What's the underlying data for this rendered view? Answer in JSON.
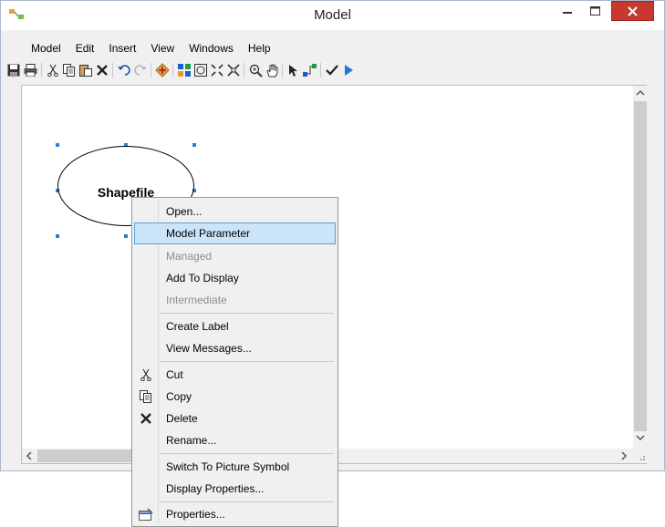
{
  "window": {
    "title": "Model"
  },
  "menu": [
    "Model",
    "Edit",
    "Insert",
    "View",
    "Windows",
    "Help"
  ],
  "toolbar_icons": [
    "save-icon",
    "print-icon",
    "cut-icon",
    "copy-icon",
    "paste-icon",
    "delete-icon",
    "undo-icon",
    "redo-icon",
    "add-data-icon",
    "auto-layout-icon",
    "full-extent-icon",
    "zoom-in-fixed-icon",
    "zoom-out-fixed-icon",
    "zoom-icon",
    "pan-icon",
    "select-icon",
    "connect-icon",
    "validate-icon",
    "run-icon"
  ],
  "canvas": {
    "element_label": "Shapefile"
  },
  "context_menu": {
    "items": [
      {
        "label": "Open...",
        "state": "normal"
      },
      {
        "label": "Model Parameter",
        "state": "hover"
      },
      {
        "label": "Managed",
        "state": "disabled"
      },
      {
        "label": "Add To Display",
        "state": "normal"
      },
      {
        "label": "Intermediate",
        "state": "disabled"
      },
      {
        "label": "Create Label",
        "state": "normal"
      },
      {
        "label": "View Messages...",
        "state": "normal"
      },
      {
        "label": "Cut",
        "state": "normal",
        "icon": "cut-icon"
      },
      {
        "label": "Copy",
        "state": "normal",
        "icon": "copy-icon"
      },
      {
        "label": "Delete",
        "state": "normal",
        "icon": "delete-icon"
      },
      {
        "label": "Rename...",
        "state": "normal"
      },
      {
        "label": "Switch To Picture Symbol",
        "state": "normal"
      },
      {
        "label": "Display Properties...",
        "state": "normal"
      },
      {
        "label": "Properties...",
        "state": "normal",
        "icon": "properties-icon"
      }
    ]
  },
  "colors": {
    "close_button": "#c7392e",
    "selection_handle": "#2a7fd4",
    "menu_hover": "#cce4f7"
  }
}
